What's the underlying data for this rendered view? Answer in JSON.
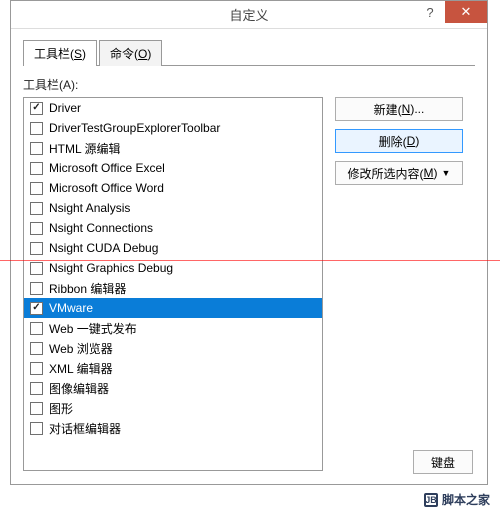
{
  "titlebar": {
    "title": "自定义"
  },
  "tabs": [
    {
      "label_pre": "工具栏(",
      "key": "S",
      "label_post": ")"
    },
    {
      "label_pre": "命令(",
      "key": "O",
      "label_post": ")"
    }
  ],
  "list_label_pre": "工具栏(",
  "list_label_key": "A",
  "list_label_post": "):",
  "items": [
    {
      "label": "Driver",
      "checked": true,
      "selected": false
    },
    {
      "label": "DriverTestGroupExplorerToolbar",
      "checked": false,
      "selected": false
    },
    {
      "label": "HTML 源编辑",
      "checked": false,
      "selected": false
    },
    {
      "label": "Microsoft Office Excel",
      "checked": false,
      "selected": false
    },
    {
      "label": "Microsoft Office Word",
      "checked": false,
      "selected": false
    },
    {
      "label": "Nsight Analysis",
      "checked": false,
      "selected": false
    },
    {
      "label": "Nsight Connections",
      "checked": false,
      "selected": false
    },
    {
      "label": "Nsight CUDA Debug",
      "checked": false,
      "selected": false
    },
    {
      "label": "Nsight Graphics Debug",
      "checked": false,
      "selected": false
    },
    {
      "label": "Ribbon 编辑器",
      "checked": false,
      "selected": false
    },
    {
      "label": "VMware",
      "checked": true,
      "selected": true
    },
    {
      "label": "Web 一键式发布",
      "checked": false,
      "selected": false
    },
    {
      "label": "Web 浏览器",
      "checked": false,
      "selected": false
    },
    {
      "label": "XML 编辑器",
      "checked": false,
      "selected": false
    },
    {
      "label": "图像编辑器",
      "checked": false,
      "selected": false
    },
    {
      "label": "图形",
      "checked": false,
      "selected": false
    },
    {
      "label": "对话框编辑器",
      "checked": false,
      "selected": false
    }
  ],
  "buttons": {
    "new_pre": "新建(",
    "new_key": "N",
    "new_post": ")...",
    "del_pre": "删除(",
    "del_key": "D",
    "del_post": ")",
    "mod_pre": "修改所选内容(",
    "mod_key": "M",
    "mod_post": ")"
  },
  "footer": {
    "keyboard": "键盘"
  },
  "watermark": "脚本之家"
}
